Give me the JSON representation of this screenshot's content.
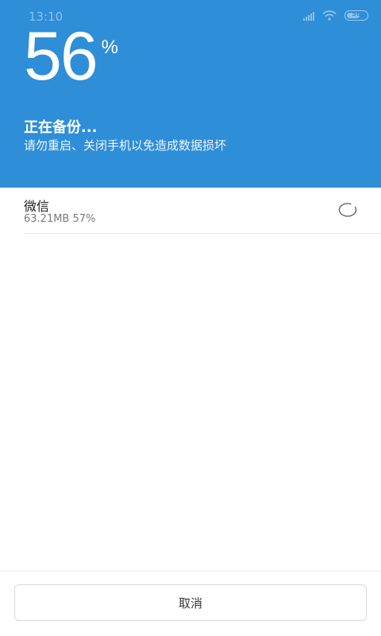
{
  "status_bar": {
    "time": "13:10",
    "battery": "56",
    "icons": [
      "signal-icon",
      "wifi-icon",
      "battery-icon"
    ]
  },
  "progress": {
    "value": "56",
    "sign": "%"
  },
  "backup": {
    "title": "正在备份...",
    "subtitle": "请勿重启、关闭手机以免造成数据损坏"
  },
  "item": {
    "name": "微信",
    "info": "63.21MB 57%",
    "status_icon": "spinner-icon"
  },
  "actions": {
    "cancel_label": "取消"
  },
  "colors": {
    "header": "#2f8ed8",
    "background": "#ffffff"
  }
}
